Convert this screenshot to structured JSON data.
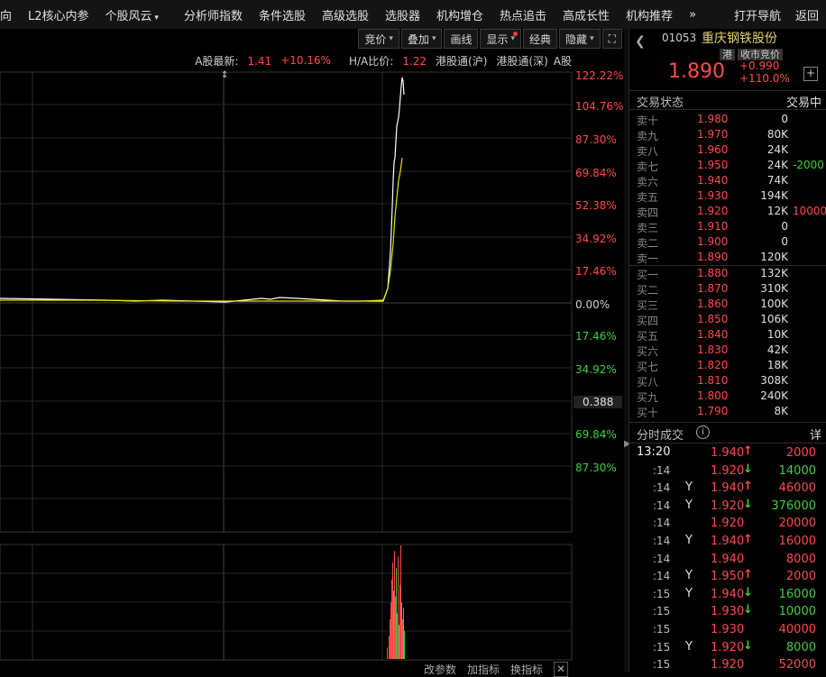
{
  "topnav": [
    "向",
    "L2核心内参",
    "个股风云",
    "分析师指数",
    "条件选股",
    "高级选股",
    "选股器",
    "机构增仓",
    "热点追击",
    "高成长性",
    "机构推荐",
    "»"
  ],
  "topnav_right": [
    "打开导航",
    "返回"
  ],
  "toolbar": [
    "竞价",
    "叠加",
    "画线",
    "显示",
    "经典",
    "隐藏",
    "⛶"
  ],
  "infoline": {
    "a_label": "A股最新:",
    "a_price": "1.41",
    "a_change": "+10.16%",
    "ha_label": "H/A比价:",
    "ha_value": "1.22",
    "sh_connect": "港股通(沪)",
    "sz_connect": "港股通(深)",
    "a_share": "A股"
  },
  "y_axis_labels": [
    "122.22%",
    "104.76%",
    "87.30%",
    "69.84%",
    "52.38%",
    "34.92%",
    "17.46%",
    "0.00%",
    "17.46%",
    "34.92%",
    "0.388",
    "69.84%",
    "87.30%"
  ],
  "bottom_tabs": [
    "改参数",
    "加指标",
    "换指标"
  ],
  "stock": {
    "code": "01053",
    "name": "重庆钢铁股份",
    "tag1": "港",
    "tag2": "收市竞价",
    "price": "1.890",
    "change": "+0.990",
    "change_pct": "+110.0%"
  },
  "status": {
    "label": "交易状态",
    "value": "交易中"
  },
  "asks": [
    {
      "label": "卖十",
      "price": "1.980",
      "vol": "0",
      "delta": ""
    },
    {
      "label": "卖九",
      "price": "1.970",
      "vol": "80K",
      "delta": ""
    },
    {
      "label": "卖八",
      "price": "1.960",
      "vol": "24K",
      "delta": ""
    },
    {
      "label": "卖七",
      "price": "1.950",
      "vol": "24K",
      "delta": "-2000"
    },
    {
      "label": "卖六",
      "price": "1.940",
      "vol": "74K",
      "delta": ""
    },
    {
      "label": "卖五",
      "price": "1.930",
      "vol": "194K",
      "delta": ""
    },
    {
      "label": "卖四",
      "price": "1.920",
      "vol": "12K",
      "delta": "10000"
    },
    {
      "label": "卖三",
      "price": "1.910",
      "vol": "0",
      "delta": ""
    },
    {
      "label": "卖二",
      "price": "1.900",
      "vol": "0",
      "delta": ""
    },
    {
      "label": "卖一",
      "price": "1.890",
      "vol": "120K",
      "delta": ""
    }
  ],
  "bids": [
    {
      "label": "买一",
      "price": "1.880",
      "vol": "132K"
    },
    {
      "label": "买二",
      "price": "1.870",
      "vol": "310K"
    },
    {
      "label": "买三",
      "price": "1.860",
      "vol": "100K"
    },
    {
      "label": "买四",
      "price": "1.850",
      "vol": "106K"
    },
    {
      "label": "买五",
      "price": "1.840",
      "vol": "10K"
    },
    {
      "label": "买六",
      "price": "1.830",
      "vol": "42K"
    },
    {
      "label": "买七",
      "price": "1.820",
      "vol": "18K"
    },
    {
      "label": "买八",
      "price": "1.810",
      "vol": "308K"
    },
    {
      "label": "买九",
      "price": "1.800",
      "vol": "240K"
    },
    {
      "label": "买十",
      "price": "1.790",
      "vol": "8K"
    }
  ],
  "trades_head": {
    "label": "分时成交",
    "info": "i",
    "detail": "详"
  },
  "trades": [
    {
      "time": "13:20",
      "y": "",
      "price": "1.940",
      "dir": "↑",
      "qty": "2000"
    },
    {
      "time": ":14",
      "y": "",
      "price": "1.920",
      "dir": "↓",
      "qty": "14000"
    },
    {
      "time": ":14",
      "y": "Y",
      "price": "1.940",
      "dir": "↑",
      "qty": "46000"
    },
    {
      "time": ":14",
      "y": "Y",
      "price": "1.920",
      "dir": "↓",
      "qty": "376000"
    },
    {
      "time": ":14",
      "y": "",
      "price": "1.920",
      "dir": "",
      "qty": "20000"
    },
    {
      "time": ":14",
      "y": "Y",
      "price": "1.940",
      "dir": "↑",
      "qty": "16000"
    },
    {
      "time": ":14",
      "y": "",
      "price": "1.940",
      "dir": "",
      "qty": "8000"
    },
    {
      "time": ":14",
      "y": "Y",
      "price": "1.950",
      "dir": "↑",
      "qty": "2000"
    },
    {
      "time": ":15",
      "y": "Y",
      "price": "1.940",
      "dir": "↓",
      "qty": "16000"
    },
    {
      "time": ":15",
      "y": "",
      "price": "1.930",
      "dir": "↓",
      "qty": "10000"
    },
    {
      "time": ":15",
      "y": "",
      "price": "1.930",
      "dir": "",
      "qty": "40000"
    },
    {
      "time": ":15",
      "y": "Y",
      "price": "1.920",
      "dir": "↓",
      "qty": "8000"
    },
    {
      "time": ":15",
      "y": "",
      "price": "1.920",
      "dir": "",
      "qty": "52000"
    }
  ],
  "colors": {
    "up": "#ff4b4b",
    "down": "#3dd13d",
    "price_line": "#ffffff",
    "avg_line": "#e6e600",
    "grid": "#2a2a2a"
  }
}
